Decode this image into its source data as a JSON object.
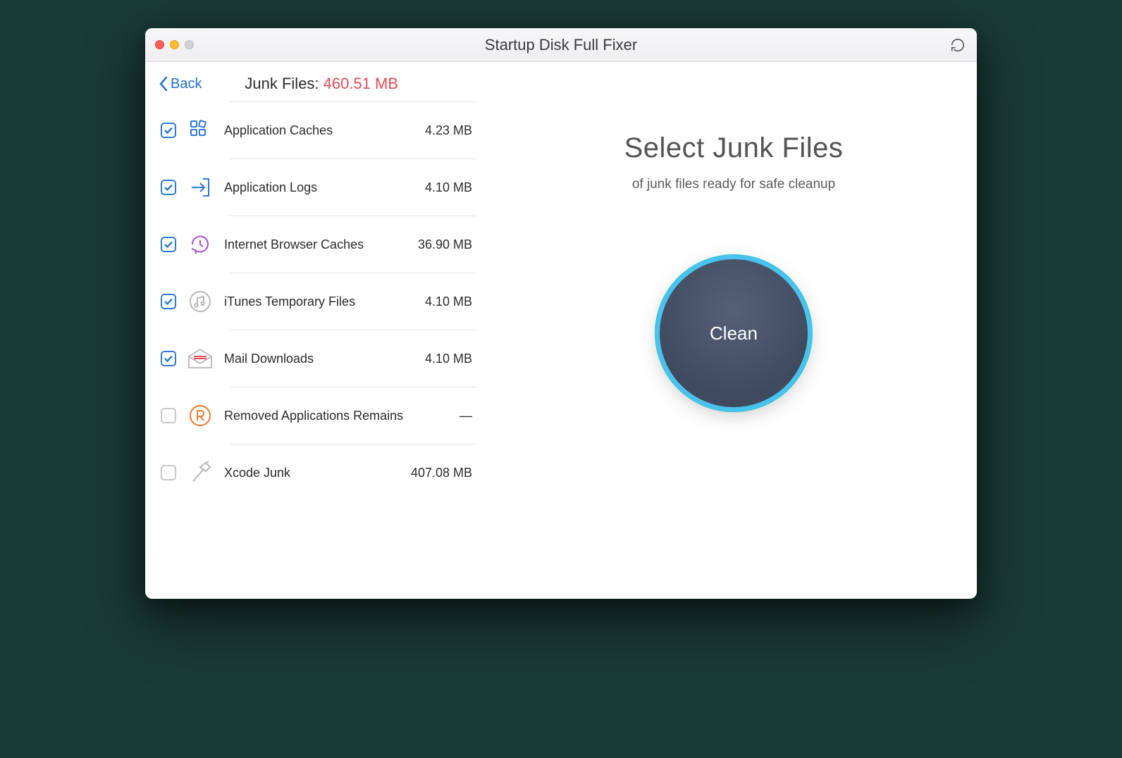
{
  "window": {
    "title_prefix": "Startup Disk Full ",
    "title_bold": "Fixer"
  },
  "sidebar": {
    "back_label": "Back",
    "header_label": "Junk Files: ",
    "header_size": "460.51 MB",
    "items": [
      {
        "label": "Application Caches",
        "size": "4.23 MB",
        "checked": true,
        "icon": "grid"
      },
      {
        "label": "Application Logs",
        "size": "4.10 MB",
        "checked": true,
        "icon": "enter"
      },
      {
        "label": "Internet Browser Caches",
        "size": "36.90 MB",
        "checked": true,
        "icon": "clock"
      },
      {
        "label": "iTunes Temporary Files",
        "size": "4.10 MB",
        "checked": true,
        "icon": "music"
      },
      {
        "label": "Mail Downloads",
        "size": "4.10 MB",
        "checked": true,
        "icon": "mail"
      },
      {
        "label": "Removed Applications Remains",
        "size": "—",
        "checked": false,
        "icon": "r"
      },
      {
        "label": "Xcode Junk",
        "size": "407.08 MB",
        "checked": false,
        "icon": "hammer"
      }
    ]
  },
  "main": {
    "title": "Select Junk Files",
    "subtitle": "of junk files ready for safe cleanup",
    "clean_label": "Clean"
  },
  "icons": {
    "grid_color": "#2f79d8",
    "enter_color": "#2f79d8",
    "clock_color": "#a84fd6",
    "music_color": "#b8b8bc",
    "mail_color": "#b8b8bc",
    "mail_accent": "#e94b57",
    "r_color": "#f0782c",
    "hammer_color": "#b8b8bc"
  }
}
